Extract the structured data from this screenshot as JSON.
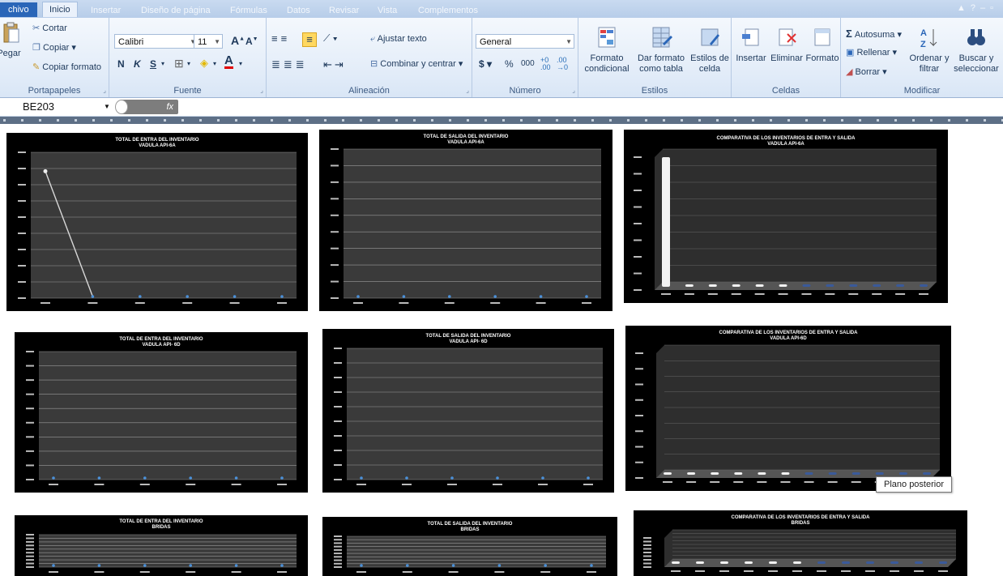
{
  "tabs": [
    "chivo",
    "Inicio",
    "Insertar",
    "Diseño de página",
    "Fórmulas",
    "Datos",
    "Revisar",
    "Vista",
    "Complementos"
  ],
  "ribbon": {
    "clipboard": {
      "paste": "Pegar",
      "cut": "Cortar",
      "copy": "Copiar",
      "copy_format": "Copiar formato",
      "label": "Portapapeles"
    },
    "font": {
      "name": "Calibri",
      "size": "11",
      "bold": "N",
      "italic": "K",
      "underline": "S",
      "label": "Fuente"
    },
    "alignment": {
      "wrap": "Ajustar texto",
      "merge": "Combinar y centrar",
      "label": "Alineación"
    },
    "number": {
      "format": "General",
      "currency": "$",
      "percent": "%",
      "thousands": "000",
      "label": "Número"
    },
    "styles": {
      "conditional": "Formato condicional",
      "as_table": "Dar formato como tabla",
      "cell_styles": "Estilos de celda",
      "label": "Estilos"
    },
    "cells": {
      "insert": "Insertar",
      "delete": "Eliminar",
      "format": "Formato",
      "label": "Celdas"
    },
    "modify": {
      "autosum": "Autosuma",
      "fill": "Rellenar",
      "clear": "Borrar",
      "sort": "Ordenar y filtrar",
      "find": "Buscar y seleccionar",
      "label": "Modificar"
    }
  },
  "formula_bar": {
    "name_box": "BE203",
    "fx": "fx"
  },
  "tooltip": "Plano posterior",
  "charts": [
    {
      "title1": "TOTAL DE ENTRA DEL INVENTARIO",
      "title2": "VADULA API-6A",
      "kind": "line_drop"
    },
    {
      "title1": "TOTAL DE SALIDA DEL INVENTARIO",
      "title2": "VADULA API-6A",
      "kind": "line_flat"
    },
    {
      "title1": "COMPARATIVA DE LOS INVENTARIOS DE ENTRA Y SALIDA",
      "title2": "VADULA API-6A",
      "kind": "bar3d_spike"
    },
    {
      "title1": "TOTAL DE ENTRA DEL INVENTARIO",
      "title2": "VADULA API- 6D",
      "kind": "line_flat"
    },
    {
      "title1": "TOTAL DE SALIDA DEL INVENTARIO",
      "title2": "VADULA API- 6D",
      "kind": "line_flat"
    },
    {
      "title1": "COMPARATIVA DE LOS INVENTARIOS DE ENTRA Y SALIDA",
      "title2": "VADULA API-6D",
      "kind": "bar3d_flat"
    },
    {
      "title1": "TOTAL DE ENTRA DEL INVENTARIO",
      "title2": "BRIDAS",
      "kind": "line_flat"
    },
    {
      "title1": "TOTAL DE SALIDA DEL INVENTARIO",
      "title2": "BRIDAS",
      "kind": "line_flat"
    },
    {
      "title1": "COMPARATIVA DE LOS INVENTARIOS DE ENTRA Y SALIDA",
      "title2": "BRIDAS",
      "kind": "bar3d_flat"
    }
  ],
  "colors": {
    "ribbon": "#dbe7f6",
    "chart_bg": "#000000",
    "plot_bg": "#3a3a3a",
    "grid": "#9a9a9a",
    "line": "#d8d8d8",
    "marker": "#4a90d9"
  }
}
